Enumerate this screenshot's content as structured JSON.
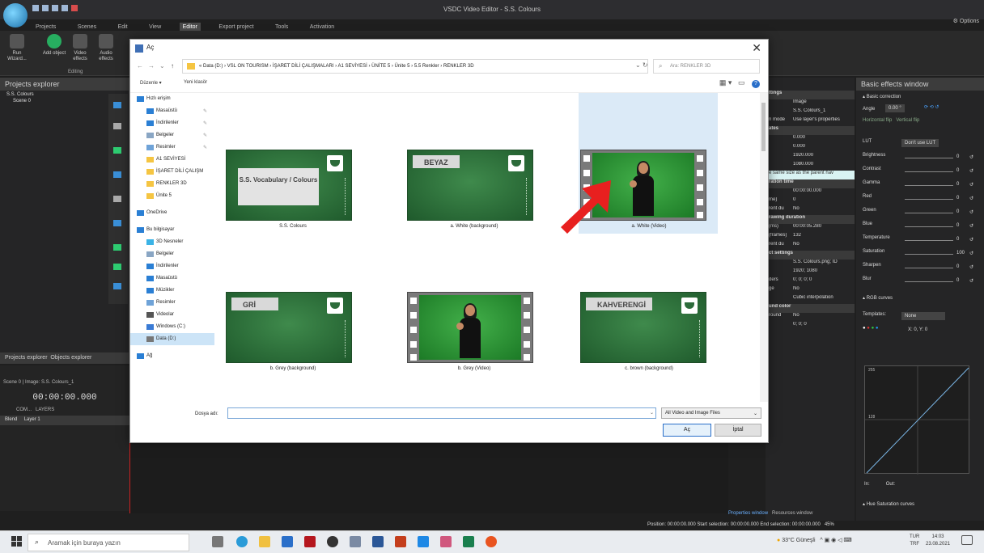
{
  "app": {
    "title": "VSDC Video Editor - S.S. Colours",
    "menu": [
      "Projects",
      "Scenes",
      "Edit",
      "View",
      "Editor",
      "Export project",
      "Tools",
      "Activation"
    ],
    "active_menu": "Editor",
    "options_label": "Options",
    "ribbon": [
      {
        "label": "Run Wizard...",
        "icon": "wizard-icon"
      },
      {
        "label": "Add object",
        "icon": "add-icon"
      },
      {
        "label": "Video effects",
        "icon": "video-effects-icon"
      },
      {
        "label": "Audio effects",
        "icon": "audio-effects-icon"
      }
    ],
    "ribbon_group": "Editing",
    "projects_explorer": {
      "title": "Projects explorer",
      "items": [
        "S.S. Colours",
        "Scene 0"
      ]
    },
    "tabs_bottom_left": [
      "Projects explorer",
      "Objects explorer"
    ],
    "scene_tabs": [
      "Scene 0",
      "Image: S.S. Colours_1"
    ],
    "time": "00:00:00.000",
    "layers_label": "LAYERS",
    "com_label": "COM...",
    "blend": "Blend",
    "layer": "Layer 1",
    "properties_title": "window",
    "properties": [
      {
        "k": "ttings",
        "v": "",
        "sec": true
      },
      {
        "k": "",
        "v": "Image"
      },
      {
        "k": "",
        "v": "S.S. Colours_1"
      },
      {
        "k": "n mode",
        "v": "Use layer's properties"
      },
      {
        "k": "ates",
        "v": "",
        "sec": true
      },
      {
        "k": "",
        "v": "0.000"
      },
      {
        "k": "",
        "v": "0.000"
      },
      {
        "k": "",
        "v": "1920.000"
      },
      {
        "k": "",
        "v": "1080.000"
      },
      {
        "k": "",
        "v": "e same size as the parent hav",
        "hl": true
      },
      {
        "k": "ration time",
        "v": "",
        "sec": true
      },
      {
        "k": "",
        "v": "00:00:00.000"
      },
      {
        "k": "me)",
        "v": "0"
      },
      {
        "k": "rent du",
        "v": "No"
      },
      {
        "k": "rawing duration",
        "v": "",
        "sec": true
      },
      {
        "k": "(ms)",
        "v": "00:00:05.280"
      },
      {
        "k": "(frames)",
        "v": "132"
      },
      {
        "k": "rent du",
        "v": "No"
      },
      {
        "k": "ct settings",
        "v": "",
        "sec": true
      },
      {
        "k": "",
        "v": "S.S. Colours.png; ID"
      },
      {
        "k": "",
        "v": "1920; 1080"
      },
      {
        "k": "ders",
        "v": "0; 0; 0; 0"
      },
      {
        "k": "ge",
        "v": "No"
      },
      {
        "k": "",
        "v": "Cubic interpolation"
      },
      {
        "k": "und color",
        "v": "",
        "sec": true
      },
      {
        "k": "round",
        "v": "No"
      },
      {
        "k": "",
        "v": "0; 0; 0"
      }
    ],
    "effects_title": "Basic effects window",
    "effects": {
      "section": "Basic correction",
      "angle_label": "Angle",
      "angle_value": "0.00 °",
      "flip_h": "Horizontal flip",
      "flip_v": "Vertical flip",
      "lut_label": "LUT",
      "lut_value": "Don't use LUT",
      "rows": [
        {
          "label": "Brightness",
          "value": "0"
        },
        {
          "label": "Contrast",
          "value": "0"
        },
        {
          "label": "Gamma",
          "value": "0"
        },
        {
          "label": "Red",
          "value": "0"
        },
        {
          "label": "Green",
          "value": "0"
        },
        {
          "label": "Blue",
          "value": "0"
        },
        {
          "label": "Temperature",
          "value": "0"
        },
        {
          "label": "Saturation",
          "value": "100"
        },
        {
          "label": "Sharpen",
          "value": "0"
        },
        {
          "label": "Blur",
          "value": "0"
        }
      ],
      "rgb_curves": "RGB curves",
      "templates_label": "Templates:",
      "templates_value": "None",
      "xy": "X: 0, Y: 0",
      "curve_top": "255",
      "curve_mid": "128",
      "in_label": "In:",
      "out_label": "Out:",
      "hue_curves": "Hue Saturation curves"
    },
    "bottom_tabs": [
      "Properties window",
      "Resources window"
    ],
    "status": "Position: 00:00:00.000   Start selection: 00:00:00.000   End selection: 00:00:00.000",
    "zoom": "45%"
  },
  "dialog": {
    "title": "Aç",
    "path": "« Data (D:)  ›  VSL ON TOURISM  ›  İŞARET DİLİ ÇALIŞMALARI  ›  A1 SEVİYESİ  ›  ÜNİTE 5  ›  Ünite 5  ›  5.5 Renkler  ›  RENKLER 3D",
    "search_placeholder": "Ara: RENKLER 3D",
    "organize": "Düzenle ▾",
    "new_folder": "Yeni klasör",
    "nav": [
      {
        "label": "Hızlı erişim",
        "icon": "star-icon",
        "color": "#2a7fd4",
        "pin": false,
        "indent": 0
      },
      {
        "label": "Masaüstü",
        "icon": "desktop-icon",
        "color": "#2a7fd4",
        "pin": true,
        "indent": 1
      },
      {
        "label": "İndirilenler",
        "icon": "download-icon",
        "color": "#2a7fd4",
        "pin": true,
        "indent": 1
      },
      {
        "label": "Belgeler",
        "icon": "documents-icon",
        "color": "#8aa6c4",
        "pin": true,
        "indent": 1
      },
      {
        "label": "Resimler",
        "icon": "pictures-icon",
        "color": "#6fa3d8",
        "pin": true,
        "indent": 1
      },
      {
        "label": "A1 SEVİYESİ",
        "icon": "folder-icon",
        "color": "#f5c542",
        "pin": false,
        "indent": 1
      },
      {
        "label": "İŞARET DİLİ ÇALIŞM",
        "icon": "folder-icon",
        "color": "#f5c542",
        "pin": false,
        "indent": 1
      },
      {
        "label": "RENKLER 3D",
        "icon": "folder-icon",
        "color": "#f5c542",
        "pin": false,
        "indent": 1
      },
      {
        "label": "Ünite 5",
        "icon": "folder-icon",
        "color": "#f5c542",
        "pin": false,
        "indent": 1
      },
      {
        "label": "OneDrive",
        "icon": "cloud-icon",
        "color": "#2a7fd4",
        "pin": false,
        "indent": 0,
        "gap": true
      },
      {
        "label": "Bu bilgisayar",
        "icon": "computer-icon",
        "color": "#2a7fd4",
        "pin": false,
        "indent": 0,
        "gap": true
      },
      {
        "label": "3D Nesneler",
        "icon": "3d-objects-icon",
        "color": "#3bb3e6",
        "pin": false,
        "indent": 1
      },
      {
        "label": "Belgeler",
        "icon": "documents-icon",
        "color": "#8aa6c4",
        "pin": false,
        "indent": 1
      },
      {
        "label": "İndirilenler",
        "icon": "download-icon",
        "color": "#2a7fd4",
        "pin": false,
        "indent": 1
      },
      {
        "label": "Masaüstü",
        "icon": "desktop-icon",
        "color": "#2a7fd4",
        "pin": false,
        "indent": 1
      },
      {
        "label": "Müzikler",
        "icon": "music-icon",
        "color": "#2a7fd4",
        "pin": false,
        "indent": 1
      },
      {
        "label": "Resimler",
        "icon": "pictures-icon",
        "color": "#6fa3d8",
        "pin": false,
        "indent": 1
      },
      {
        "label": "Videolar",
        "icon": "videos-icon",
        "color": "#555555",
        "pin": false,
        "indent": 1
      },
      {
        "label": "Windows (C:)",
        "icon": "drive-icon",
        "color": "#3a7bd5",
        "pin": false,
        "indent": 1
      },
      {
        "label": "Data (D:)",
        "icon": "drive-icon",
        "color": "#777777",
        "pin": false,
        "indent": 1,
        "selected": true
      },
      {
        "label": "Ağ",
        "icon": "network-icon",
        "color": "#2a7fd4",
        "pin": false,
        "indent": 0,
        "gap": true
      }
    ],
    "files": [
      {
        "name": "S.S. Colours",
        "kind": "vocab",
        "card": "S.S. Vocabulary / Colours"
      },
      {
        "name": "a. White (background)",
        "kind": "board",
        "card": "BEYAZ"
      },
      {
        "name": "a. White (Video)",
        "kind": "film",
        "selected": true
      },
      {
        "name": "b. Grey (background)",
        "kind": "board",
        "card": "GRİ"
      },
      {
        "name": "b. Grey (Video)",
        "kind": "film"
      },
      {
        "name": "c. brown (background)",
        "kind": "board",
        "card": "KAHVERENGİ"
      }
    ],
    "filename_label": "Dosya adı:",
    "filename_value": "",
    "filter": "All Video and Image Files",
    "open": "Aç",
    "cancel": "İptal"
  },
  "taskbar": {
    "search_placeholder": "Aramak için buraya yazın",
    "weather": "33°C  Güneşli",
    "lang": "TUR",
    "lang2": "TRF",
    "time": "14:03",
    "date": "23.08.2021"
  }
}
